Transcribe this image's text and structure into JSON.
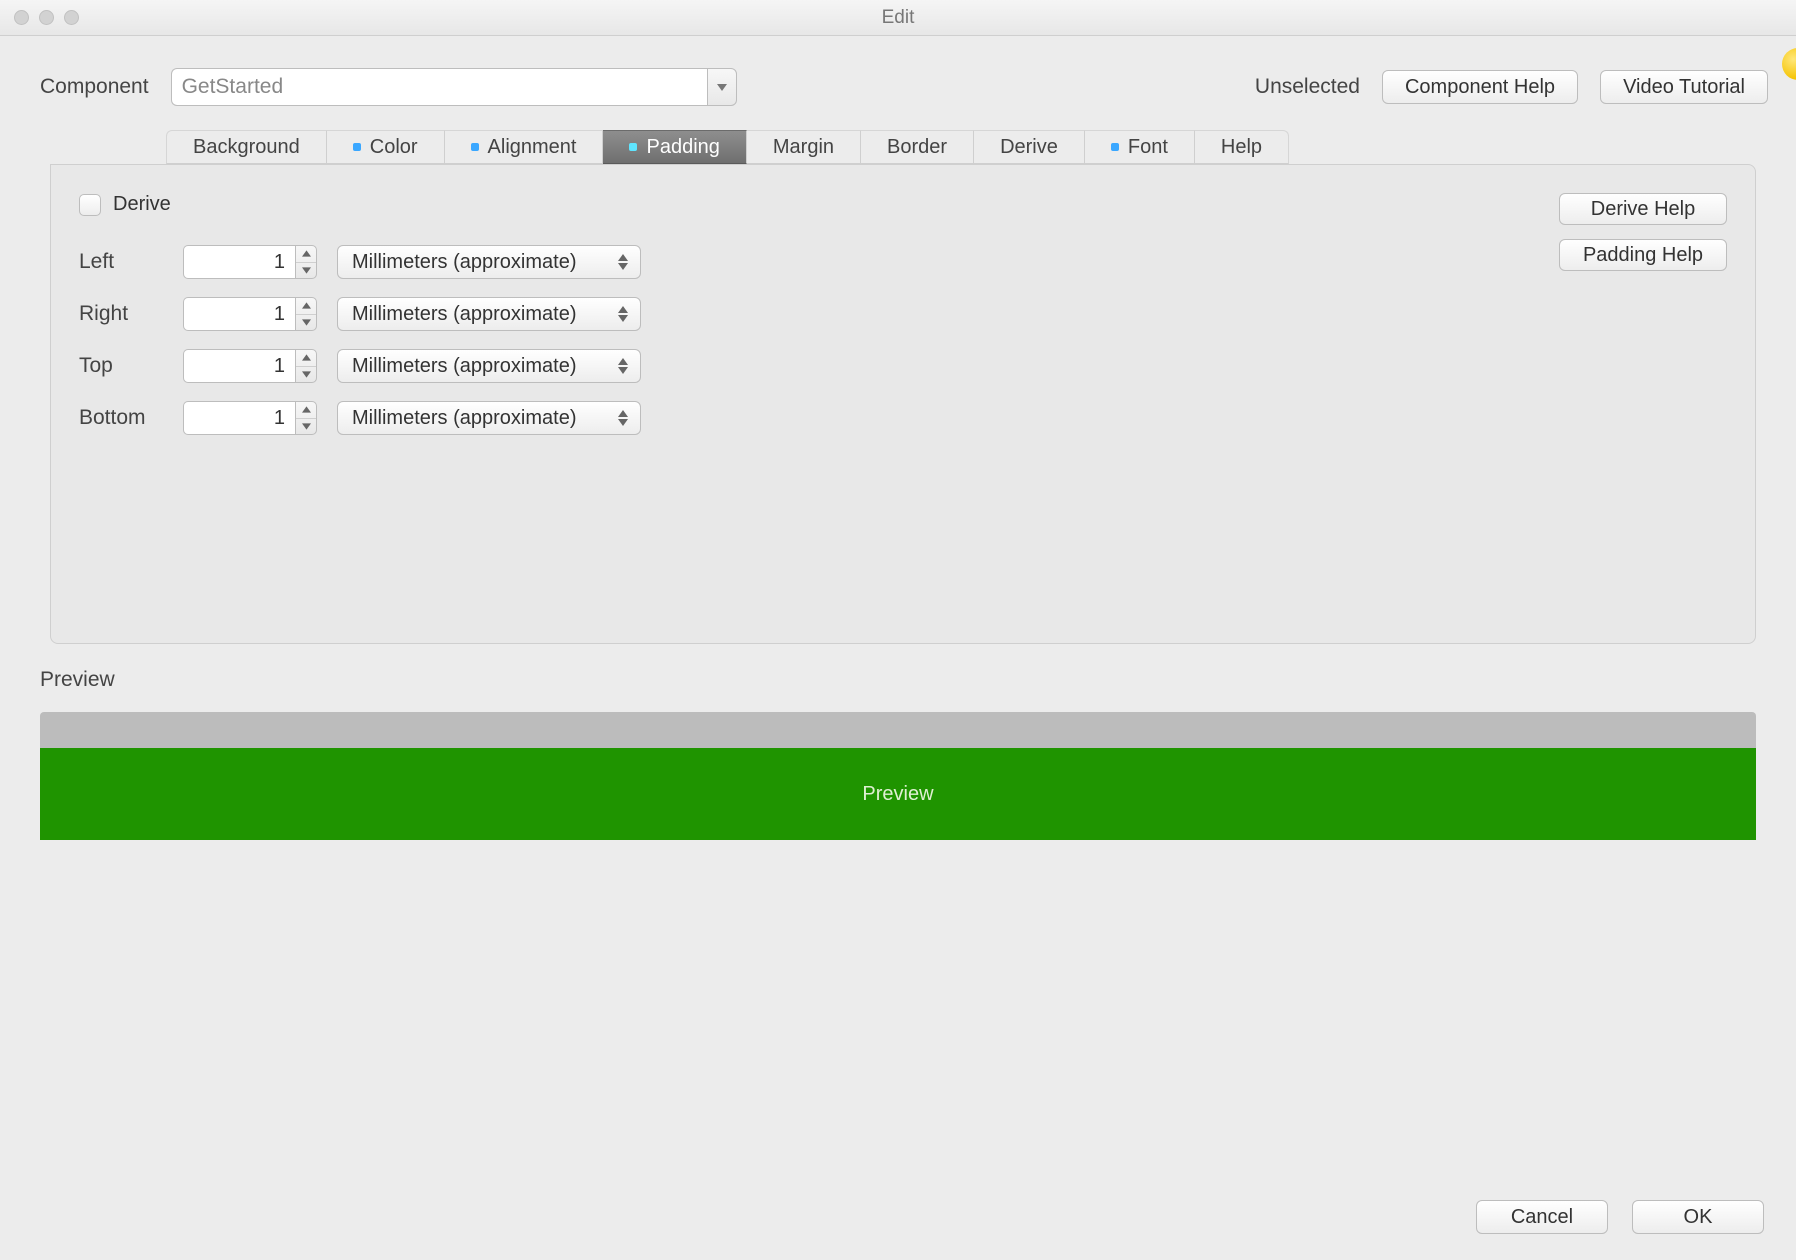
{
  "window": {
    "title": "Edit"
  },
  "component": {
    "label": "Component",
    "value": "GetStarted",
    "state": "Unselected"
  },
  "top_buttons": {
    "component_help": "Component Help",
    "video_tutorial": "Video Tutorial"
  },
  "tabs": [
    {
      "label": "Background",
      "dotted": false
    },
    {
      "label": "Color",
      "dotted": true
    },
    {
      "label": "Alignment",
      "dotted": true
    },
    {
      "label": "Padding",
      "dotted": true,
      "active": true
    },
    {
      "label": "Margin",
      "dotted": false
    },
    {
      "label": "Border",
      "dotted": false
    },
    {
      "label": "Derive",
      "dotted": false
    },
    {
      "label": "Font",
      "dotted": true
    },
    {
      "label": "Help",
      "dotted": false
    }
  ],
  "panel": {
    "derive": {
      "label": "Derive",
      "checked": false
    },
    "help_buttons": {
      "derive_help": "Derive Help",
      "padding_help": "Padding Help"
    },
    "fields": [
      {
        "key": "left",
        "label": "Left",
        "value": "1",
        "unit": "Millimeters (approximate)"
      },
      {
        "key": "right",
        "label": "Right",
        "value": "1",
        "unit": "Millimeters (approximate)"
      },
      {
        "key": "top",
        "label": "Top",
        "value": "1",
        "unit": "Millimeters (approximate)"
      },
      {
        "key": "bottom",
        "label": "Bottom",
        "value": "1",
        "unit": "Millimeters (approximate)"
      }
    ]
  },
  "preview": {
    "section_label": "Preview",
    "tile_label": "Preview",
    "color": "#1f9400"
  },
  "bottom": {
    "cancel": "Cancel",
    "ok": "OK"
  }
}
